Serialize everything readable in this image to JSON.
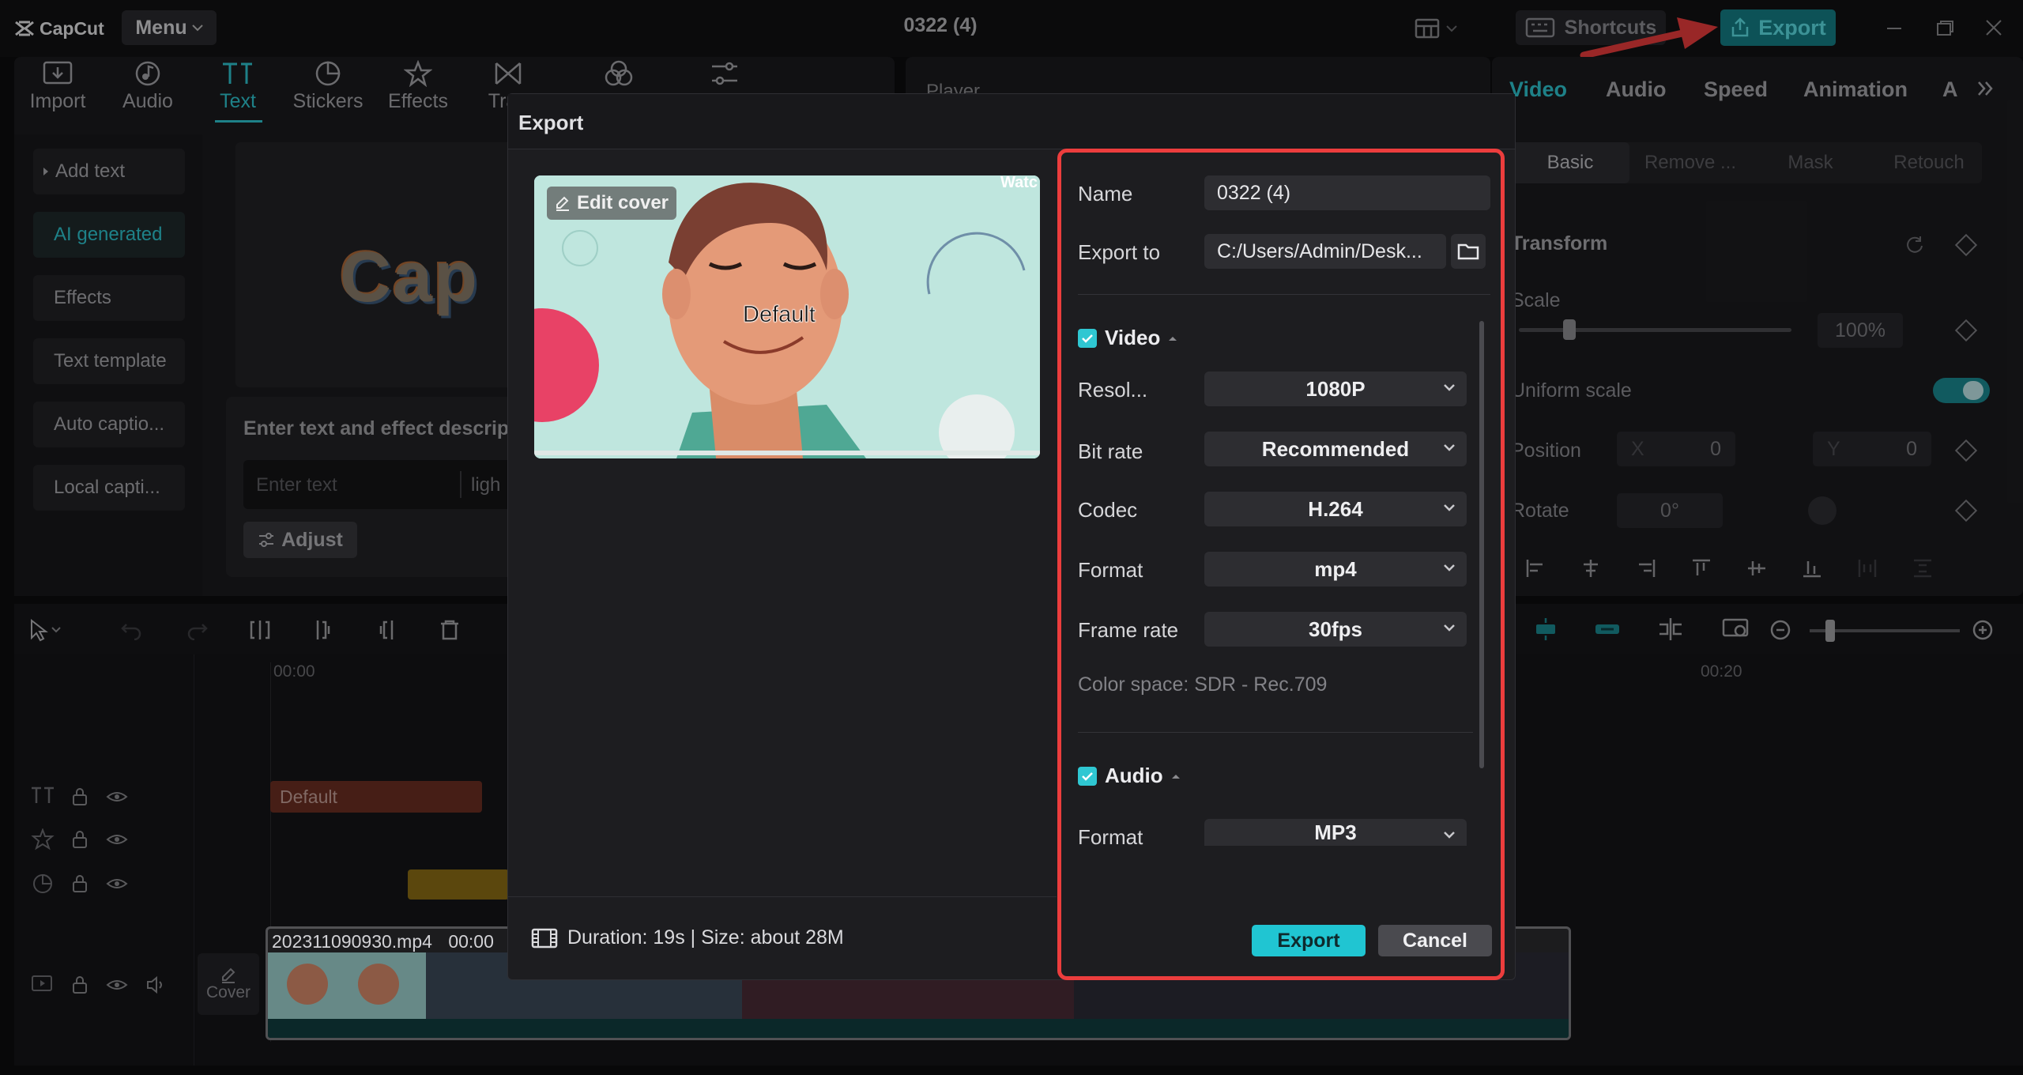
{
  "app": {
    "logo_text": "CapCut",
    "menu_label": "Menu",
    "project_title": "0322 (4)",
    "shortcuts_label": "Shortcuts",
    "export_label": "Export"
  },
  "toolbar": {
    "tools": [
      "Import",
      "Audio",
      "Text",
      "Stickers",
      "Effects",
      "Tran"
    ],
    "active_tool": "Text"
  },
  "text_panel": {
    "side_items": [
      "Add text",
      "AI generated",
      "Effects",
      "Text template",
      "Auto captio...",
      "Local capti..."
    ],
    "preview_text": "Cap",
    "ai_heading": "Enter text and effect descrip",
    "ai_placeholder": "Enter text",
    "ai_suffix": "ligh",
    "adjust_label": "Adjust"
  },
  "player": {
    "label": "Player"
  },
  "inspector": {
    "tabs": [
      "Video",
      "Audio",
      "Speed",
      "Animation",
      "A"
    ],
    "sub_tabs": [
      "Basic",
      "Remove ...",
      "Mask",
      "Retouch"
    ],
    "transform_heading": "Transform",
    "scale_label": "Scale",
    "scale_value": "100%",
    "uniform_scale_label": "Uniform scale",
    "position_label": "Position",
    "pos_x_label": "X",
    "pos_x_value": "0",
    "pos_y_label": "Y",
    "pos_y_value": "0",
    "rotate_label": "Rotate",
    "rotate_value": "0°"
  },
  "timeline": {
    "tick_start": "00:00",
    "tick_end": "00:20",
    "text_clip": "Default",
    "video_clip": "202311090930.mp4",
    "video_clip_time": "00:00",
    "cover_label": "Cover"
  },
  "export_dialog": {
    "title": "Export",
    "edit_cover_label": "Edit cover",
    "cover_caption": "Default",
    "cover_watermark": "Watc",
    "name_label": "Name",
    "name_value": "0322 (4)",
    "export_to_label": "Export to",
    "export_to_value": "C:/Users/Admin/Desk...",
    "video_section": "Video",
    "resolution_label": "Resol...",
    "resolution_value": "1080P",
    "bitrate_label": "Bit rate",
    "bitrate_value": "Recommended",
    "codec_label": "Codec",
    "codec_value": "H.264",
    "format_label": "Format",
    "format_value": "mp4",
    "framerate_label": "Frame rate",
    "framerate_value": "30fps",
    "color_space": "Color space: SDR - Rec.709",
    "audio_section": "Audio",
    "audio_format_label": "Format",
    "audio_format_value": "MP3",
    "duration_text": "Duration: 19s | Size: about 28M",
    "export_button": "Export",
    "cancel_button": "Cancel"
  },
  "colors": {
    "accent": "#2fc7d2",
    "highlight_box": "#ec3d3d",
    "export_primary": "#20c5d2"
  }
}
